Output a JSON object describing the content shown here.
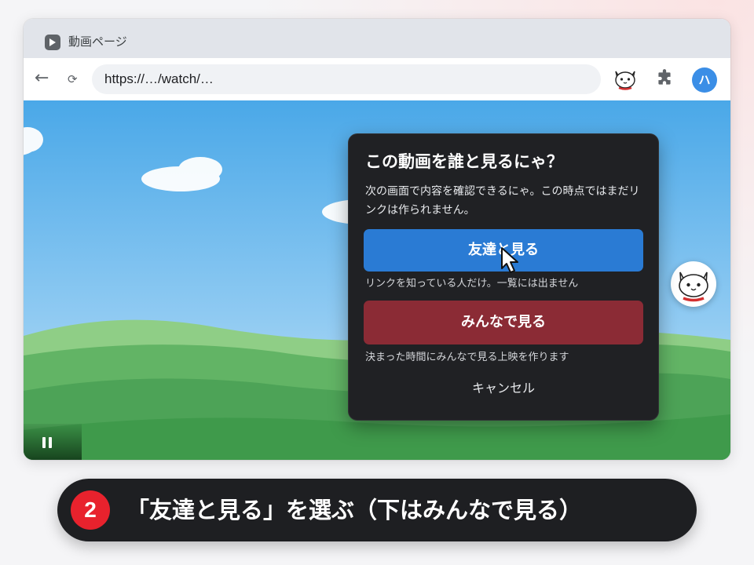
{
  "browser": {
    "tab_title": "動画ページ",
    "url": "https://…/watch/…",
    "profile_initial": "ハ"
  },
  "dialog": {
    "title": "この動画を誰と見るにゃ？",
    "description": "次の画面で内容を確認できるにゃ。この時点ではまだリンクは作られません。",
    "friends_button": "友達と見る",
    "friends_hint": "リンクを知っている人だけ。一覧には出ません",
    "everyone_button": "みんなで見る",
    "everyone_hint": "決まった時間にみんなで見る上映を作ります",
    "cancel_label": "キャンセル"
  },
  "caption": {
    "step_number": "2",
    "text": "「友達と見る」を選ぶ（下はみんなで見る）"
  },
  "colors": {
    "friends_button": "#2a7bd4",
    "everyone_button": "#8b2b35",
    "step_badge": "#e8222d"
  }
}
